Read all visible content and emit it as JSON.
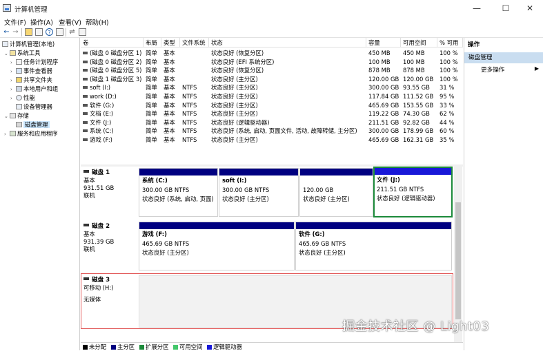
{
  "window": {
    "title": "计算机管理",
    "min": "—",
    "max": "☐",
    "close": "✕"
  },
  "menu": [
    "文件(F)",
    "操作(A)",
    "查看(V)",
    "帮助(H)"
  ],
  "tree": [
    {
      "label": "计算机管理(本地)",
      "exp": "",
      "icon": "computer-management-icon"
    },
    {
      "label": "系统工具",
      "exp": "⌄",
      "icon": "system-tools-icon"
    },
    {
      "label": "任务计划程序",
      "exp": "›",
      "icon": "task-scheduler-icon"
    },
    {
      "label": "事件查看器",
      "exp": "›",
      "icon": "event-viewer-icon"
    },
    {
      "label": "共享文件夹",
      "exp": "›",
      "icon": "shared-folders-icon"
    },
    {
      "label": "本地用户和组",
      "exp": "›",
      "icon": "users-icon"
    },
    {
      "label": "性能",
      "exp": "›",
      "icon": "performance-icon"
    },
    {
      "label": "设备管理器",
      "exp": "",
      "icon": "device-manager-icon"
    },
    {
      "label": "存储",
      "exp": "⌄",
      "icon": "storage-icon"
    },
    {
      "label": "磁盘管理",
      "exp": "",
      "icon": "disk-management-icon"
    },
    {
      "label": "服务和应用程序",
      "exp": "›",
      "icon": "services-icon"
    }
  ],
  "columns": [
    "卷",
    "布局",
    "类型",
    "文件系统",
    "状态",
    "容量",
    "可用空间",
    "% 可用"
  ],
  "volumes": [
    [
      "(磁盘 0 磁盘分区 1)",
      "简单",
      "基本",
      "",
      "状态良好 (恢复分区)",
      "450 MB",
      "450 MB",
      "100 %"
    ],
    [
      "(磁盘 0 磁盘分区 2)",
      "简单",
      "基本",
      "",
      "状态良好 (EFI 系统分区)",
      "100 MB",
      "100 MB",
      "100 %"
    ],
    [
      "(磁盘 0 磁盘分区 5)",
      "简单",
      "基本",
      "",
      "状态良好 (恢复分区)",
      "878 MB",
      "878 MB",
      "100 %"
    ],
    [
      "(磁盘 1 磁盘分区 3)",
      "简单",
      "基本",
      "",
      "状态良好 (主分区)",
      "120.00 GB",
      "120.00 GB",
      "100 %"
    ],
    [
      "soft (I:)",
      "简单",
      "基本",
      "NTFS",
      "状态良好 (主分区)",
      "300.00 GB",
      "93.55 GB",
      "31 %"
    ],
    [
      "work (D:)",
      "简单",
      "基本",
      "NTFS",
      "状态良好 (主分区)",
      "117.84 GB",
      "111.52 GB",
      "95 %"
    ],
    [
      "软件 (G:)",
      "简单",
      "基本",
      "NTFS",
      "状态良好 (主分区)",
      "465.69 GB",
      "153.55 GB",
      "33 %"
    ],
    [
      "文档 (E:)",
      "简单",
      "基本",
      "NTFS",
      "状态良好 (主分区)",
      "119.22 GB",
      "74.30 GB",
      "62 %"
    ],
    [
      "文件 (J:)",
      "简单",
      "基本",
      "NTFS",
      "状态良好 (逻辑驱动器)",
      "211.51 GB",
      "92.82 GB",
      "44 %"
    ],
    [
      "系统 (C:)",
      "简单",
      "基本",
      "NTFS",
      "状态良好 (系统, 启动, 页面文件, 活动, 故障转储, 主分区)",
      "300.00 GB",
      "178.99 GB",
      "60 %"
    ],
    [
      "游戏 (F:)",
      "简单",
      "基本",
      "NTFS",
      "状态良好 (主分区)",
      "465.69 GB",
      "162.31 GB",
      "35 %"
    ]
  ],
  "disks": [
    {
      "name": "磁盘 1",
      "type": "基本",
      "size": "931.51 GB",
      "state": "联机"
    },
    {
      "name": "磁盘 2",
      "type": "基本",
      "size": "931.39 GB",
      "state": "联机"
    },
    {
      "name": "磁盘 3",
      "type": "可移动 (H:)",
      "size": "",
      "state": "无媒体"
    }
  ],
  "parts": [
    {
      "name": "系统 (C:)",
      "size": "300.00 GB NTFS",
      "status": "状态良好 (系统, 启动, 页面)"
    },
    {
      "name": "soft (I:)",
      "size": "300.00 GB NTFS",
      "status": "状态良好 (主分区)"
    },
    {
      "name": "",
      "size": "120.00 GB",
      "status": "状态良好 (主分区)"
    },
    {
      "name": "文件 (J:)",
      "size": "211.51 GB NTFS",
      "status": "状态良好 (逻辑驱动器)"
    },
    {
      "name": "游戏 (F:)",
      "size": "465.69 GB NTFS",
      "status": "状态良好 (主分区)"
    },
    {
      "name": "软件 (G:)",
      "size": "465.69 GB NTFS",
      "status": "状态良好 (主分区)"
    }
  ],
  "legend": [
    {
      "label": "未分配",
      "color": "#000000"
    },
    {
      "label": "主分区",
      "color": "#000080"
    },
    {
      "label": "扩展分区",
      "color": "#1c8a3a"
    },
    {
      "label": "可用空间",
      "color": "#44c76b"
    },
    {
      "label": "逻辑驱动器",
      "color": "#1818d8"
    }
  ],
  "actions": {
    "header": "操作",
    "section": "磁盘管理",
    "more": "更多操作",
    "arrow": "▶"
  },
  "watermark": "掘金技术社区 @ Light03"
}
